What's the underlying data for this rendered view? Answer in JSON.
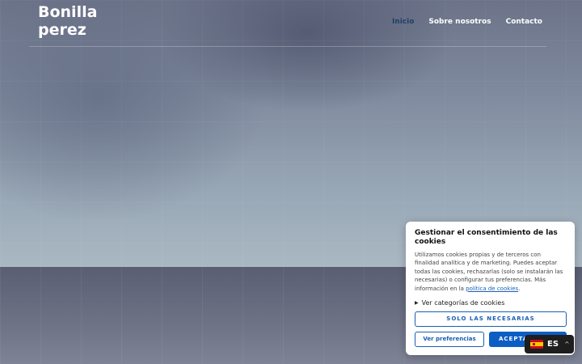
{
  "brand": {
    "line1": "Bonilla",
    "line2": "perez"
  },
  "nav": {
    "items": [
      "Inicio",
      "Sobre nosotros",
      "Contacto"
    ],
    "active": "Inicio"
  },
  "cookie": {
    "title": "Gestionar el consentimiento de las cookies",
    "body": "Utilizamos cookies propias y de terceros con finalidad analítica y de marketing. Puedes aceptar todas las cookies, rechazarlas (solo se instalarán las necesarias) o configurar tus preferencias. Más información en la ",
    "policy_link": "política de cookies",
    "body_end": ".",
    "categories_toggle": "Ver categorías de cookies",
    "necessary_button": "SOLO LAS NECESARIAS",
    "preferences_button": "Ver preferencias",
    "accept_button": "ACEPTAR"
  },
  "language": {
    "code": "ES",
    "flag_icon": "spain-flag-icon"
  },
  "colors": {
    "accent": "#1a5fb4",
    "accept_bg": "#0d5ec4",
    "nav_active": "#1f3f66"
  }
}
